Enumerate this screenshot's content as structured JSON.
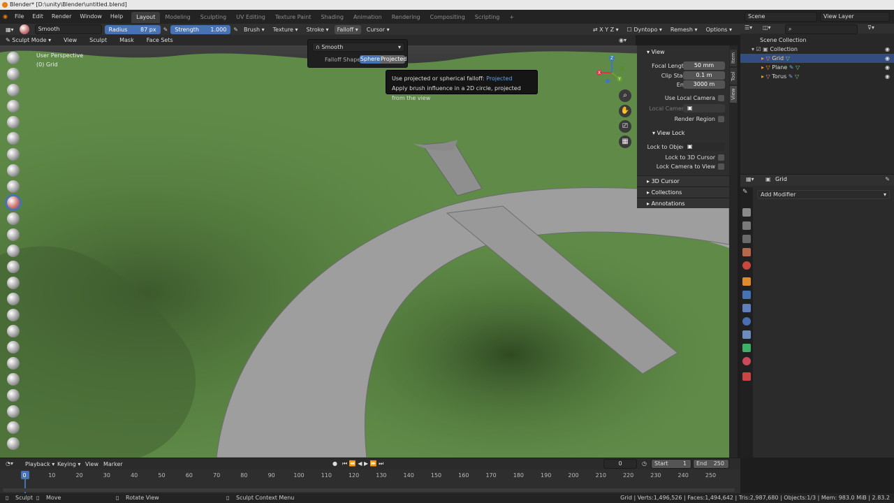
{
  "titlebar": {
    "title": "Blender* [D:\\unity\\Blender\\untitled.blend]"
  },
  "menu": [
    "File",
    "Edit",
    "Render",
    "Window",
    "Help"
  ],
  "workspaces": [
    "Layout",
    "Modeling",
    "Sculpting",
    "UV Editing",
    "Texture Paint",
    "Shading",
    "Animation",
    "Rendering",
    "Compositing",
    "Scripting",
    "+"
  ],
  "scene": {
    "label": "Scene",
    "view_layer": "View Layer"
  },
  "toolheader": {
    "brush_name": "Smooth",
    "radius_label": "Radius",
    "radius_value": "87 px",
    "strength_label": "Strength",
    "strength_value": "1.000",
    "menus": [
      "Brush",
      "Texture",
      "Stroke",
      "Falloff",
      "Cursor"
    ],
    "dyntopo": "Dyntopo",
    "remesh": "Remesh",
    "options": "Options"
  },
  "modeheader": {
    "mode": "Sculpt Mode",
    "menus": [
      "View",
      "Sculpt",
      "Mask",
      "Face Sets"
    ]
  },
  "viewport": {
    "perspective": "User Perspective",
    "object": "(0) Grid"
  },
  "falloff_popup": {
    "curve": "Smooth",
    "shape_label": "Falloff Shape",
    "opt1": "Sphere",
    "opt2": "Projected"
  },
  "tooltip": {
    "line1_a": "Use projected or spherical falloff:",
    "line1_b": "Projected",
    "line2": "Apply brush influence in a 2D circle, projected from the view"
  },
  "npanel": {
    "view_hdr": "View",
    "focal_label": "Focal Length",
    "focal_value": "50 mm",
    "clip_start_label": "Clip Start",
    "clip_start_value": "0.1 m",
    "end_label": "End",
    "end_value": "3000 m",
    "local_cam_label": "Use Local Camera",
    "local_camera": "Local Camera",
    "render_region": "Render Region",
    "view_lock_hdr": "View Lock",
    "lock_obj": "Lock to Object",
    "lock_cursor": "Lock to 3D Cursor",
    "lock_cam": "Lock Camera to View",
    "cursor_hdr": "3D Cursor",
    "collections_hdr": "Collections",
    "annotations_hdr": "Annotations",
    "tabs": [
      "Item",
      "Tool",
      "View"
    ]
  },
  "outliner": {
    "root": "Scene Collection",
    "collection": "Collection",
    "items": [
      "Grid",
      "Plane",
      "Torus"
    ]
  },
  "properties": {
    "object": "Grid",
    "add_modifier": "Add Modifier"
  },
  "timeline": {
    "menus": [
      "Playback",
      "Keying",
      "View",
      "Marker"
    ],
    "current": "0",
    "start_label": "Start",
    "start": "1",
    "end_label": "End",
    "end": "250",
    "ticks": [
      "0",
      "10",
      "20",
      "30",
      "40",
      "50",
      "60",
      "70",
      "80",
      "90",
      "100",
      "110",
      "120",
      "130",
      "140",
      "150",
      "160",
      "170",
      "180",
      "190",
      "200",
      "210",
      "220",
      "230",
      "240",
      "250"
    ]
  },
  "status": {
    "sculpt": "Sculpt",
    "move": "Move",
    "rotate": "Rotate View",
    "context": "Sculpt Context Menu",
    "stats": "Grid | Verts:1,496,526 | Faces:1,494,642 | Tris:2,987,680 | Objects:1/3 | Mem: 983.0 MiB | 2.83.2"
  },
  "colors": {
    "accent": "#4772b3",
    "terrain": "#5f8a47",
    "road": "#9e9e9e"
  }
}
